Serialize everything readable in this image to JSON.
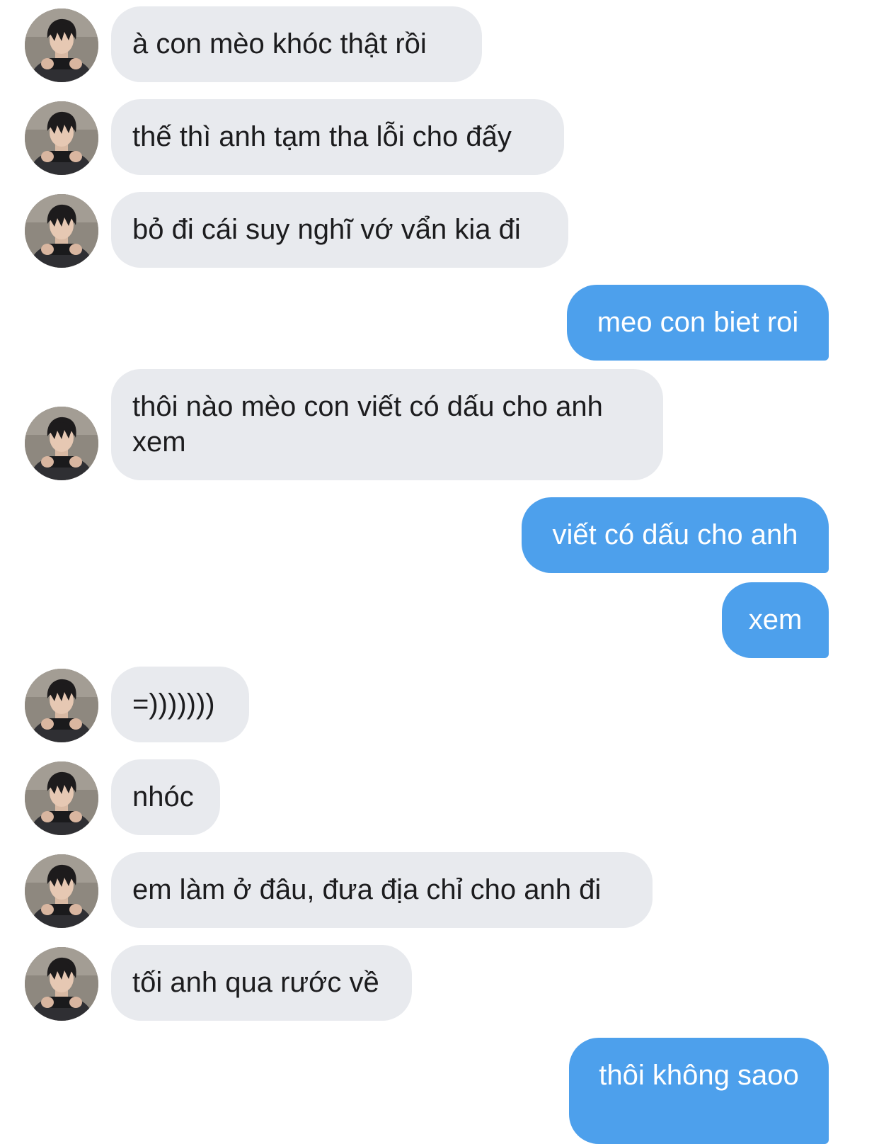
{
  "conversation": {
    "messages": [
      {
        "sender": "other",
        "text": "à con mèo khóc thật rồi"
      },
      {
        "sender": "other",
        "text": "thế thì anh tạm tha lỗi cho đấy"
      },
      {
        "sender": "other",
        "text": "bỏ đi cái suy nghĩ vớ vẩn kia đi"
      },
      {
        "sender": "me",
        "text": "meo con biet roi"
      },
      {
        "sender": "other",
        "text": "thôi nào mèo con viết có dấu cho anh xem"
      },
      {
        "sender": "me",
        "text": "viết có dấu cho anh"
      },
      {
        "sender": "me",
        "text": "xem"
      },
      {
        "sender": "other",
        "text": "=)))))))"
      },
      {
        "sender": "other",
        "text": "nhóc"
      },
      {
        "sender": "other",
        "text": "em làm ở đâu, đưa địa chỉ cho anh đi"
      },
      {
        "sender": "other",
        "text": "tối anh qua rước về"
      },
      {
        "sender": "me",
        "text": "thôi không saoo"
      }
    ]
  },
  "colors": {
    "incoming_bubble": "#e8eaee",
    "outgoing_bubble": "#4da0ec",
    "incoming_text": "#1c1c1e",
    "outgoing_text": "#ffffff"
  },
  "icons": {
    "avatar": "profile-photo-avatar-icon"
  }
}
